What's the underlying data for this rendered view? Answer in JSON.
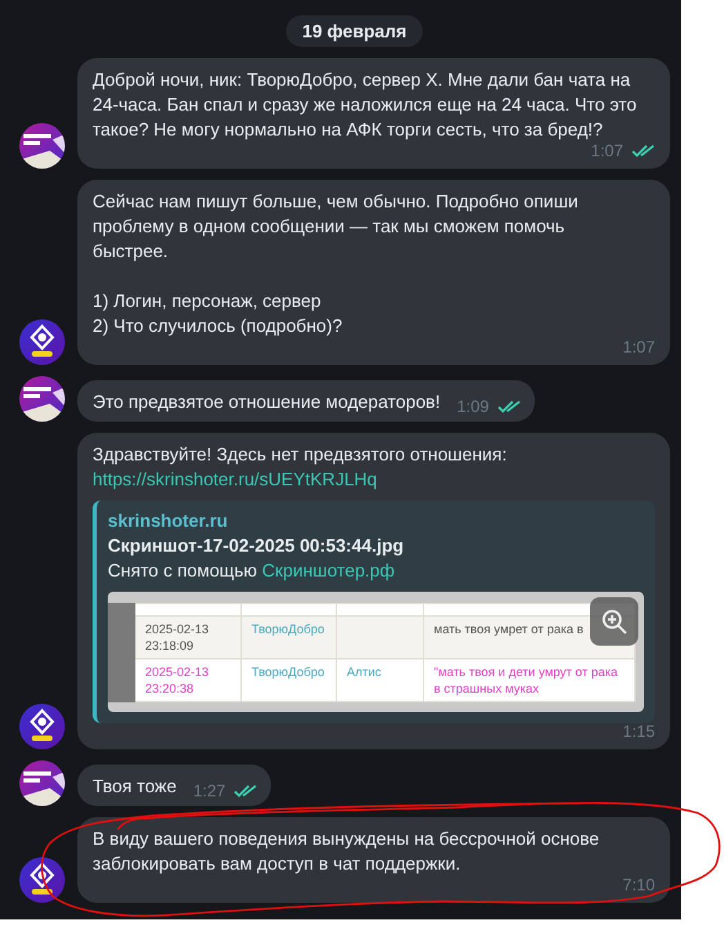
{
  "date_pill": "19 февраля",
  "messages": [
    {
      "avatar": {
        "kind": "user"
      },
      "kind": "text",
      "text": "Доброй ночи, ник: ТворюДобро, сервер X. Мне дали бан чата на 24-часа. Бан спал и сразу же наложился еще на 24 часа. Что это такое? Не могу нормально на АФК торги сесть, что за бред!?",
      "time": "1:07",
      "read": true
    },
    {
      "avatar": {
        "kind": "support"
      },
      "kind": "text",
      "text": "Сейчас нам пишут больше, чем обычно. Подробно опиши проблему в одном сообщении — так мы сможем помочь быстрее.\n\n1) Логин, персонаж, сервер\n2) Что случилось (подробно)?",
      "time": "1:07",
      "read": false
    },
    {
      "avatar": {
        "kind": "user"
      },
      "kind": "text",
      "text": "Это предвзятое отношение модераторов!",
      "time": "1:09",
      "read": true
    },
    {
      "avatar": {
        "kind": "support"
      },
      "kind": "link_preview",
      "text": "Здравствуйте! Здесь нет предвзятого отношения:",
      "link": "https://skrinshoter.ru/sUEYtKRJLHq",
      "preview": {
        "site": "skrinshoter.ru",
        "title": "Скриншот-17-02-2025 00:53:44.jpg",
        "description": "Снято с помощью",
        "description_link": "Скриншотер.рф",
        "screenshot_rows": [
          {
            "highlighted": false,
            "cells": [
              "2025-02-13 23:18:09",
              "ТворюДобро",
              "",
              "мать твоя умрет от рака в"
            ]
          },
          {
            "highlighted": true,
            "cells": [
              "2025-02-13 23:20:38",
              "ТворюДобро",
              "Алтис",
              "\"мать твоя и дети умрут от рака в страшных муках"
            ]
          }
        ]
      },
      "time": "1:15",
      "read": false
    },
    {
      "avatar": {
        "kind": "user"
      },
      "kind": "text",
      "text": "Твоя тоже",
      "time": "1:27",
      "read": true
    },
    {
      "avatar": {
        "kind": "support"
      },
      "kind": "text",
      "text": "В виду вашего поведения вынуждены на бессрочной основе заблокировать вам доступ в чат поддержки.",
      "time": "7:10",
      "read": false
    }
  ],
  "markup": [
    {
      "kind": "ellipse"
    }
  ]
}
